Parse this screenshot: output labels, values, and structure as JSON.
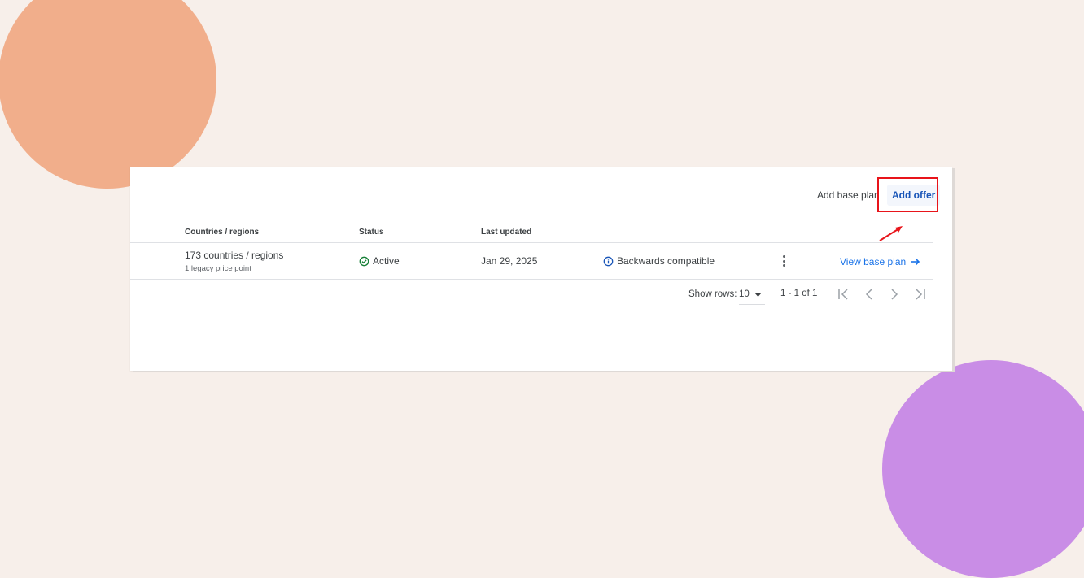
{
  "colors": {
    "background": "#f7efea",
    "accent": "#1a73e8",
    "highlight": "#e8141a",
    "active_green": "#188038",
    "blob_orange": "#f1ae8b",
    "blob_purple": "#c98de6"
  },
  "actions": {
    "add_base_plan": "Add base plan",
    "add_offer": "Add offer"
  },
  "table": {
    "headers": {
      "countries": "Countries / regions",
      "status": "Status",
      "last_updated": "Last updated"
    },
    "rows": [
      {
        "countries": "173 countries / regions",
        "countries_sub": "1 legacy price point",
        "status": "Active",
        "status_icon": "check-circle-icon",
        "last_updated": "Jan 29, 2025",
        "compat": "Backwards compatible",
        "compat_icon": "info-icon",
        "link": "View base plan"
      }
    ]
  },
  "pagination": {
    "show_rows_label": "Show rows:",
    "rows_value": "10",
    "range": "1 - 1 of 1"
  }
}
